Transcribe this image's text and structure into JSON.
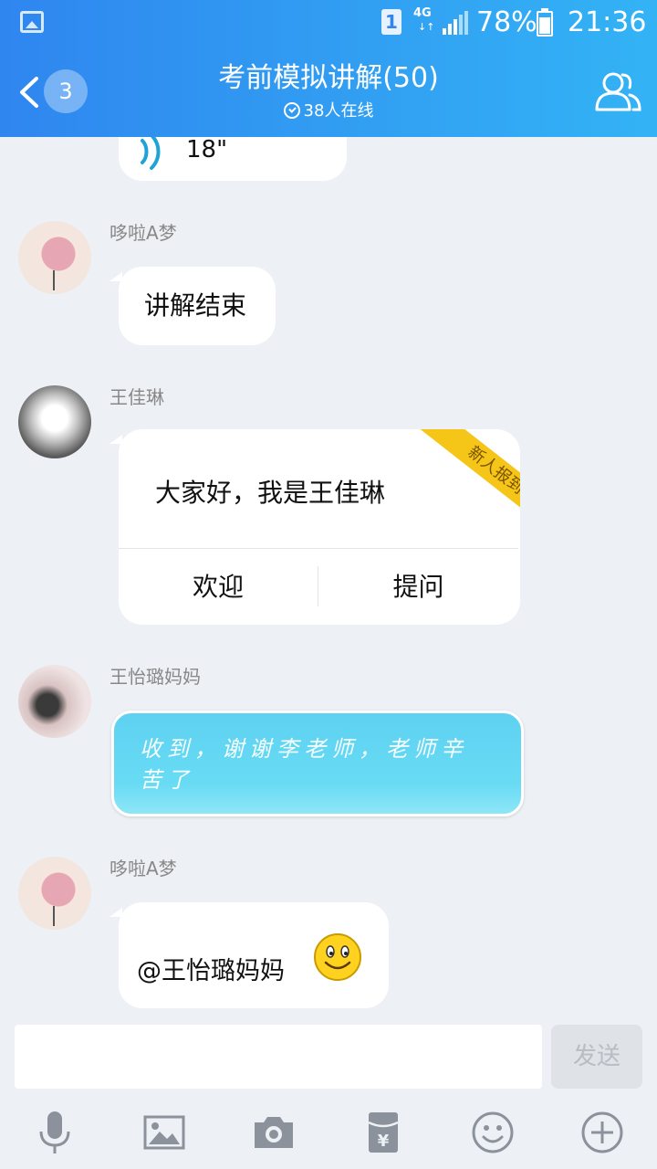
{
  "status_bar": {
    "sim_slot": "1",
    "network": "4G",
    "network_arrows": "↓↑",
    "battery": "78%",
    "time": "21:36"
  },
  "header": {
    "back_badge": "3",
    "title": "考前模拟讲解(50)",
    "online": "38人在线"
  },
  "chat": {
    "voice_prev": {
      "duration": "18\""
    },
    "messages": [
      {
        "sender": "哆啦A梦",
        "text": "讲解结束"
      },
      {
        "sender": "王佳琳",
        "text": "大家好，我是王佳琳",
        "ribbon": "新人报到",
        "actions": [
          "欢迎",
          "提问"
        ]
      },
      {
        "sender": "王怡璐妈妈",
        "text_line1": "收到，谢谢李老师，老师辛",
        "text_line2": "苦了"
      },
      {
        "sender": "哆啦A梦",
        "text": "@王怡璐妈妈"
      }
    ]
  },
  "input": {
    "placeholder": "",
    "send_label": "发送"
  },
  "toolbar": {
    "icons": [
      "microphone-icon",
      "image-icon",
      "camera-icon",
      "red-packet-icon",
      "emoji-icon",
      "plus-icon"
    ]
  },
  "colors": {
    "header_start": "#2f86ef",
    "header_end": "#33b3f5",
    "background": "#edf0f5",
    "bubble_blue": "#5fd3f0"
  }
}
